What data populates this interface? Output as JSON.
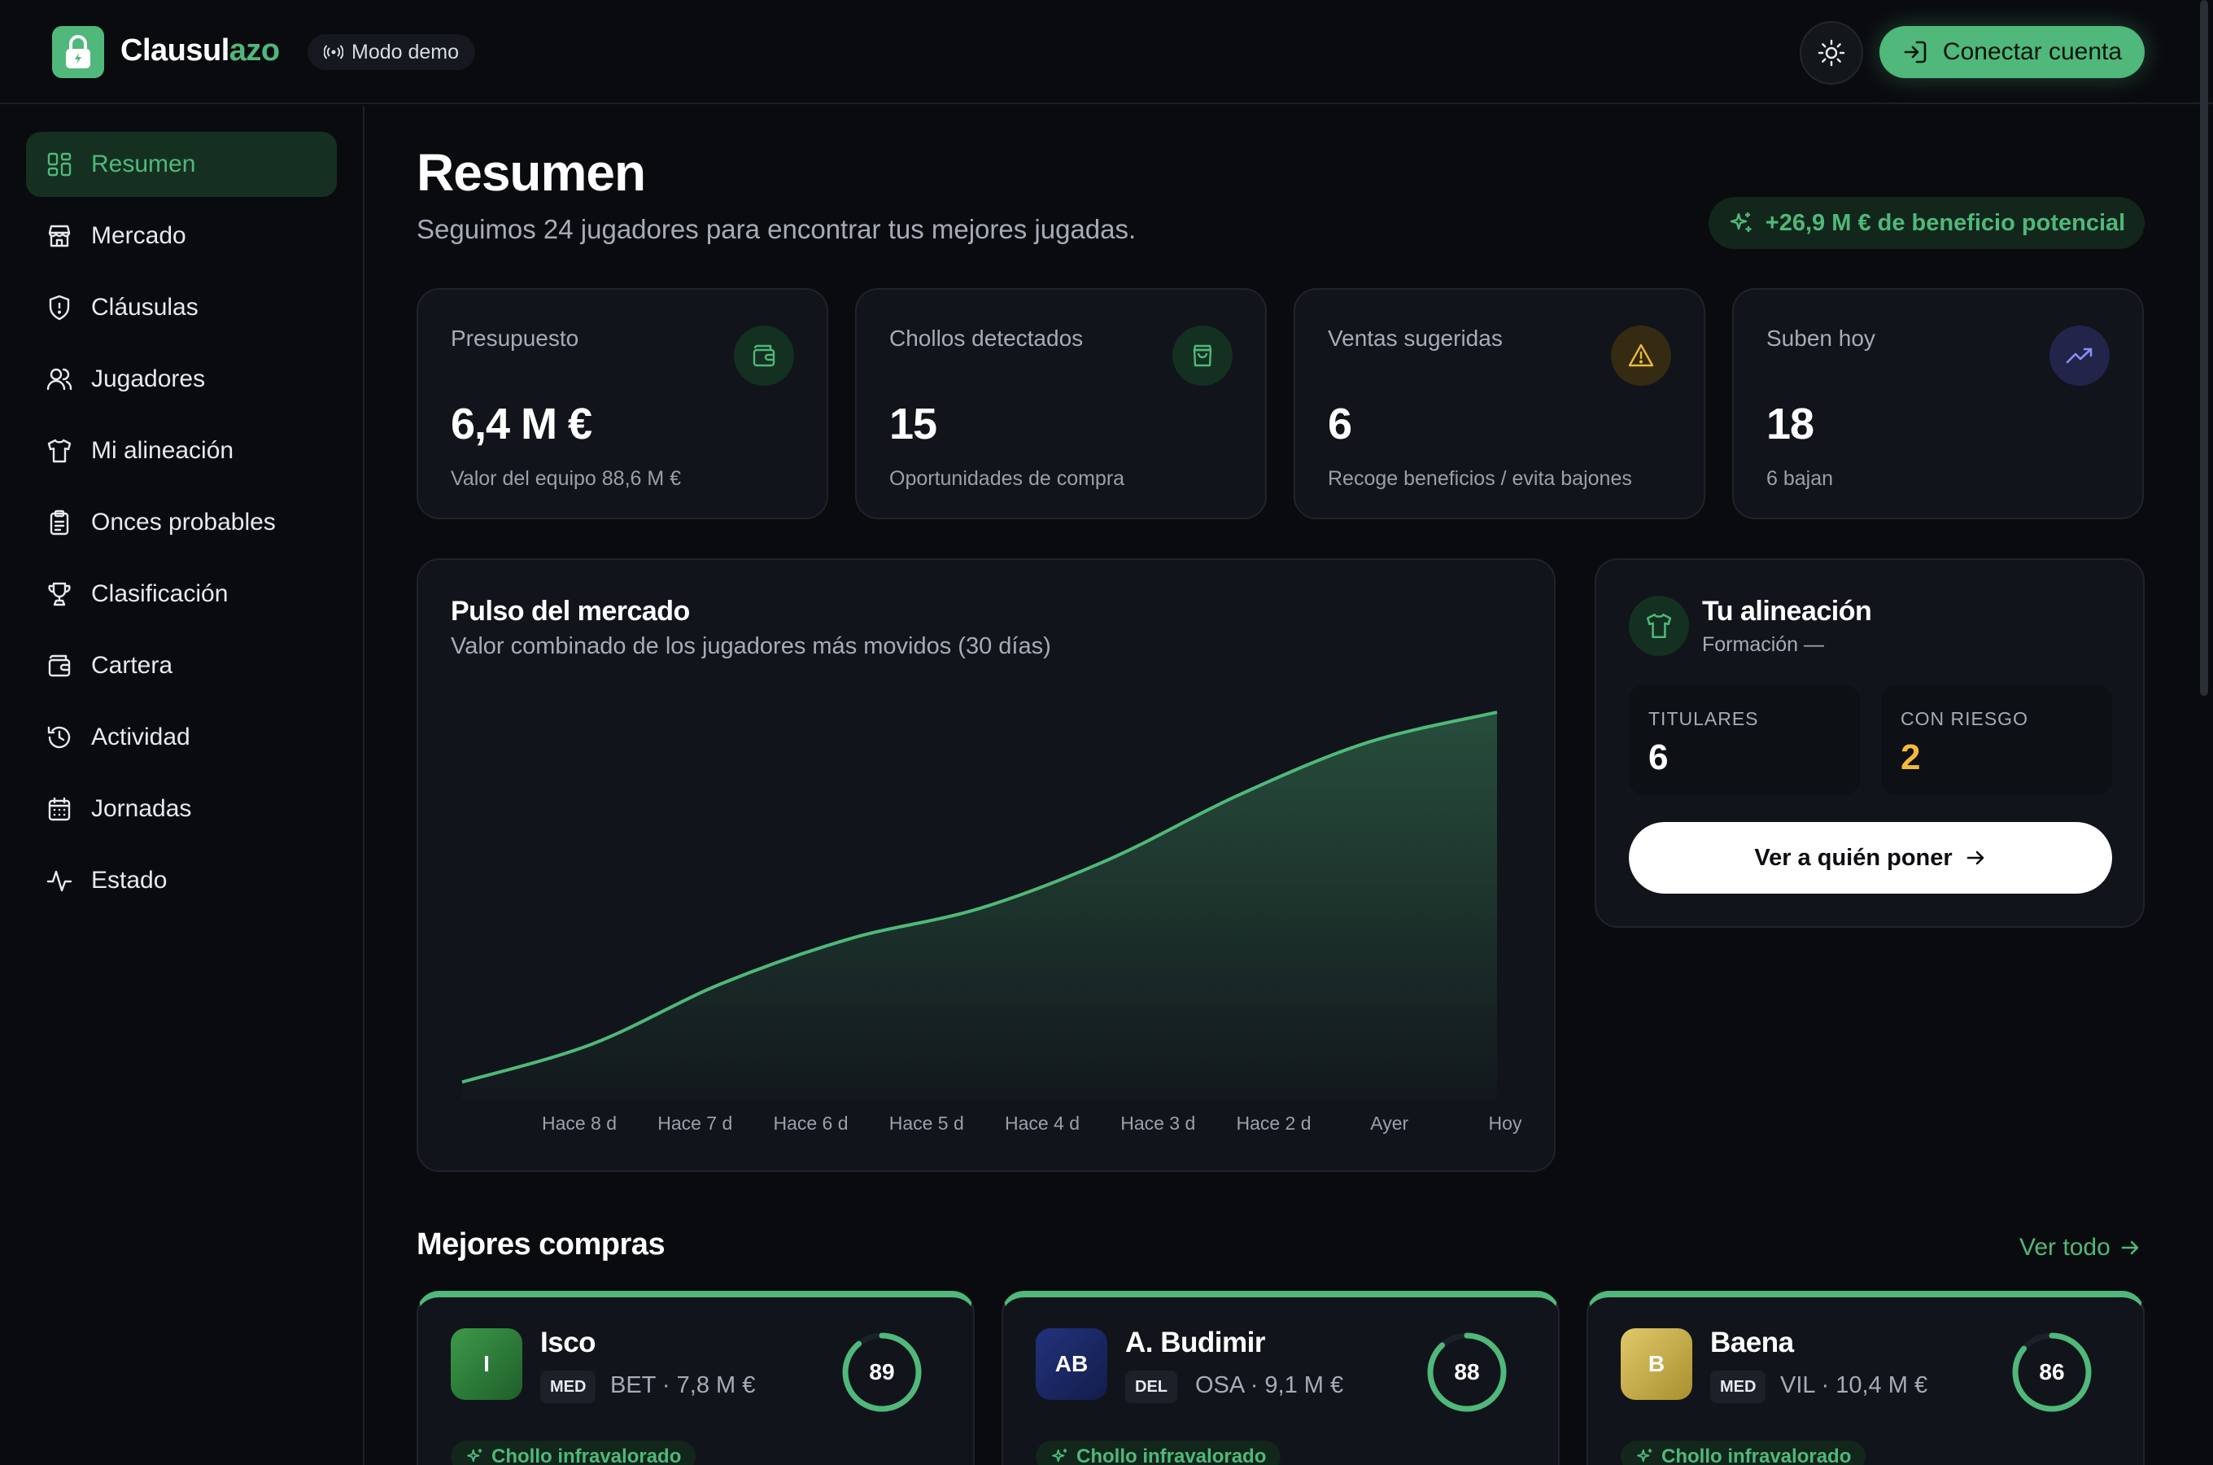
{
  "header": {
    "brand_main": "Clausul",
    "brand_accent": "azo",
    "demo_label": "Modo demo",
    "connect_label": "Conectar cuenta"
  },
  "sidebar": {
    "items": [
      {
        "label": "Resumen",
        "icon": "grid-icon",
        "active": true
      },
      {
        "label": "Mercado",
        "icon": "store-icon"
      },
      {
        "label": "Cláusulas",
        "icon": "shield-icon"
      },
      {
        "label": "Jugadores",
        "icon": "users-icon"
      },
      {
        "label": "Mi alineación",
        "icon": "shirt-icon"
      },
      {
        "label": "Onces probables",
        "icon": "clipboard-icon"
      },
      {
        "label": "Clasificación",
        "icon": "trophy-icon"
      },
      {
        "label": "Cartera",
        "icon": "wallet-icon"
      },
      {
        "label": "Actividad",
        "icon": "history-icon"
      },
      {
        "label": "Jornadas",
        "icon": "calendar-icon"
      },
      {
        "label": "Estado",
        "icon": "activity-icon"
      }
    ]
  },
  "main": {
    "title": "Resumen",
    "subtitle": "Seguimos 24 jugadores para encontrar tus mejores jugadas.",
    "benefit": "+26,9 M € de beneficio potencial"
  },
  "stats": [
    {
      "label": "Presupuesto",
      "value": "6,4 M €",
      "sub": "Valor del equipo 88,6 M €",
      "icon": "wallet-icon",
      "color": "#4fb87a"
    },
    {
      "label": "Chollos detectados",
      "value": "15",
      "sub": "Oportunidades de compra",
      "icon": "bag-icon",
      "color": "#4fb87a"
    },
    {
      "label": "Ventas sugeridas",
      "value": "6",
      "sub": "Recoge beneficios / evita bajones",
      "icon": "warning-icon",
      "color": "#e8b93c"
    },
    {
      "label": "Suben hoy",
      "value": "18",
      "sub": "6 bajan",
      "icon": "trending-up-icon",
      "color": "#8b8cf5"
    }
  ],
  "chart_data": {
    "type": "area",
    "title": "Pulso del mercado",
    "subtitle": "Valor combinado de los jugadores más movidos (30 días)",
    "x": [
      "Hace 8 d",
      "Hace 7 d",
      "Hace 6 d",
      "Hace 5 d",
      "Hace 4 d",
      "Hace 3 d",
      "Hace 2 d",
      "Ayer",
      "Hoy"
    ],
    "values": [
      4,
      14,
      30,
      42,
      50,
      63,
      80,
      94,
      102
    ],
    "ylim": [
      0,
      110
    ],
    "grid": false,
    "color": "#4fb87a"
  },
  "lineup": {
    "title": "Tu alineación",
    "formation": "Formación —",
    "starters_label": "TITULARES",
    "starters_value": "6",
    "risk_label": "CON RIESGO",
    "risk_value": "2",
    "button": "Ver a quién poner"
  },
  "best_buys": {
    "title": "Mejores compras",
    "see_all": "Ver todo",
    "players": [
      {
        "initials": "I",
        "name": "Isco",
        "pos": "MED",
        "meta": "BET · 7,8 M €",
        "score": "89",
        "score_pct": 0.89,
        "tag": "Chollo infravalorado",
        "avatar_color": "#2e7d3a"
      },
      {
        "initials": "AB",
        "name": "A. Budimir",
        "pos": "DEL",
        "meta": "OSA · 9,1 M €",
        "score": "88",
        "score_pct": 0.88,
        "tag": "Chollo infravalorado",
        "avatar_color": "#1b2a6b"
      },
      {
        "initials": "B",
        "name": "Baena",
        "pos": "MED",
        "meta": "VIL · 10,4 M €",
        "score": "86",
        "score_pct": 0.86,
        "tag": "Chollo infravalorado",
        "avatar_color": "#c9b04a"
      }
    ]
  }
}
